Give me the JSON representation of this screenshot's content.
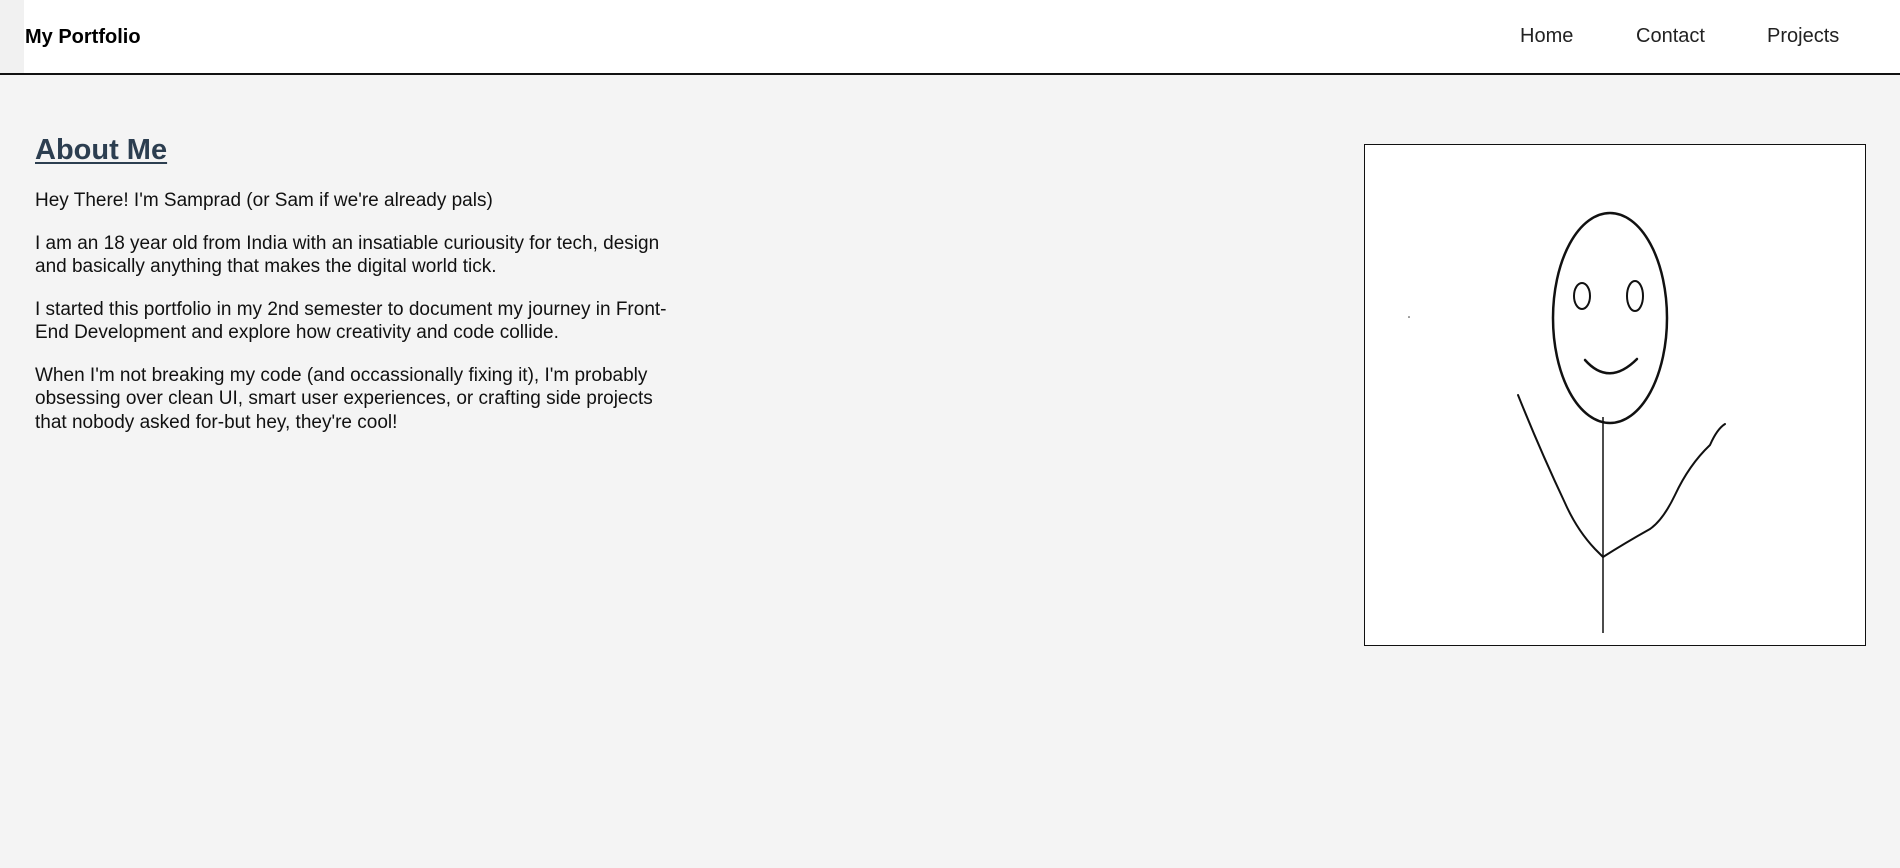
{
  "header": {
    "brand": "My Portfolio",
    "nav": {
      "home": "Home",
      "contact": "Contact",
      "projects": "Projects"
    }
  },
  "about": {
    "title": "About Me",
    "paragraphs": [
      "Hey There! I'm Samprad (or Sam if we're already pals)",
      "I am an 18 year old from India with an insatiable curiousity for tech, design and basically anything that makes the digital world tick.",
      "I started this portfolio in my 2nd semester to document my journey in Front-End Development and explore how creativity and code collide.",
      "When I'm not breaking my code (and occassionally fixing it), I'm probably obsessing over clean UI, smart user experiences, or crafting side projects that nobody asked for-but hey, they're cool!"
    ]
  },
  "image": {
    "icon": "stick-figure-drawing",
    "description_visible": ""
  },
  "colors": {
    "background": "#f4f4f4",
    "header_bg": "#ffffff",
    "title": "#2c3e50"
  }
}
